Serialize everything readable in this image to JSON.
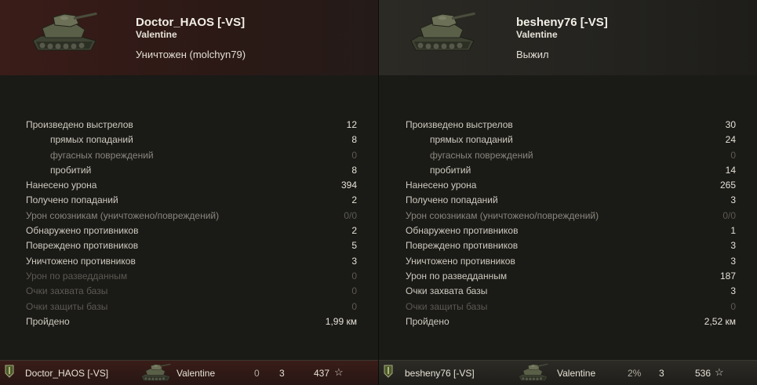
{
  "players": [
    {
      "name": "Doctor_HAOS [-VS]",
      "tank": "Valentine",
      "status": "Уничтожен (molchyn79)",
      "stats": [
        {
          "label": "Произведено выстрелов",
          "value": "12"
        },
        {
          "label": "прямых попаданий",
          "value": "8"
        },
        {
          "label": "фугасных повреждений",
          "value": "0"
        },
        {
          "label": "пробитий",
          "value": "8"
        },
        {
          "label": "Нанесено урона",
          "value": "394"
        },
        {
          "label": "Получено попаданий",
          "value": "2"
        },
        {
          "label": "Урон союзникам (уничтожено/повреждений)",
          "value": "0/0"
        },
        {
          "label": "Обнаружено противников",
          "value": "2"
        },
        {
          "label": "Повреждено противников",
          "value": "5"
        },
        {
          "label": "Уничтожено противников",
          "value": "3"
        },
        {
          "label": "Урон по разведданным",
          "value": "0"
        },
        {
          "label": "Очки захвата базы",
          "value": "0"
        },
        {
          "label": "Очки защиты базы",
          "value": "0"
        },
        {
          "label": "Пройдено",
          "value": "1,99 км"
        }
      ],
      "footer": {
        "name": "Doctor_HAOS [-VS]",
        "tank": "Valentine",
        "col_a": "0",
        "col_b": "3",
        "xp": "437",
        "star": "☆"
      }
    },
    {
      "name": "besheny76 [-VS]",
      "tank": "Valentine",
      "status": "Выжил",
      "stats": [
        {
          "label": "Произведено выстрелов",
          "value": "30"
        },
        {
          "label": "прямых попаданий",
          "value": "24"
        },
        {
          "label": "фугасных повреждений",
          "value": "0"
        },
        {
          "label": "пробитий",
          "value": "14"
        },
        {
          "label": "Нанесено урона",
          "value": "265"
        },
        {
          "label": "Получено попаданий",
          "value": "3"
        },
        {
          "label": "Урон союзникам (уничтожено/повреждений)",
          "value": "0/0"
        },
        {
          "label": "Обнаружено противников",
          "value": "1"
        },
        {
          "label": "Повреждено противников",
          "value": "3"
        },
        {
          "label": "Уничтожено противников",
          "value": "3"
        },
        {
          "label": "Урон по разведданным",
          "value": "187"
        },
        {
          "label": "Очки захвата базы",
          "value": "3"
        },
        {
          "label": "Очки защиты базы",
          "value": "0"
        },
        {
          "label": "Пройдено",
          "value": "2,52 км"
        }
      ],
      "footer": {
        "name": "besheny76 [-VS]",
        "tank": "Valentine",
        "col_a": "2%",
        "col_b": "3",
        "xp": "536",
        "star": "☆"
      }
    }
  ],
  "icons": {
    "tank": "tank-icon",
    "shield": "shield-icon",
    "star": "star-icon"
  },
  "colors": {
    "destroyed_header": "#3a1c18",
    "survived_header": "#2c2a25"
  }
}
